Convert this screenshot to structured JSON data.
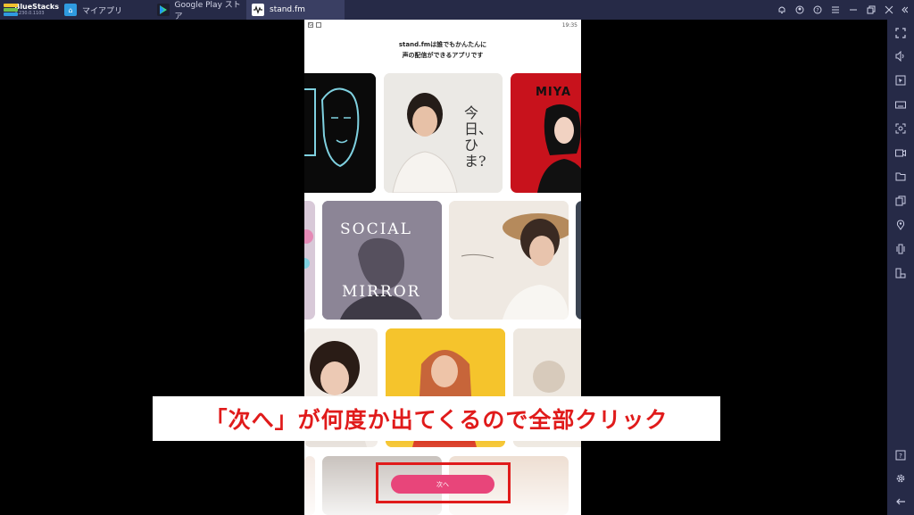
{
  "app": {
    "name": "BlueStacks",
    "version": "4.230.0.1103"
  },
  "tabs": [
    {
      "label": "マイアプリ",
      "icon": "home-icon",
      "active": false
    },
    {
      "label": "Google Play ストア",
      "icon": "play-store-icon",
      "active": false
    },
    {
      "label": "stand.fm",
      "icon": "standfm-icon",
      "active": true
    }
  ],
  "window_controls": [
    "bell-icon",
    "account-icon",
    "help-icon",
    "menu-icon",
    "minimize-icon",
    "restore-icon",
    "close-icon"
  ],
  "sidebar": {
    "top_icons": [
      "fullscreen-icon",
      "volume-icon",
      "cursor-icon",
      "keyboard-icon",
      "screenshot-icon",
      "record-icon",
      "folder-icon",
      "multi-instance-icon",
      "location-icon",
      "shake-icon",
      "rotate-icon"
    ],
    "bottom_icons": [
      "help-icon",
      "settings-icon",
      "back-icon"
    ]
  },
  "phone": {
    "status": {
      "time": "19:35",
      "left_glyph": "G"
    },
    "headline_line1": "stand.fmは誰でもかんたんに",
    "headline_line2": "声の配信ができるアプリです",
    "cards": {
      "social_line1": "SOCIAL",
      "social_line2": "MIRROR",
      "miya": "MIYA",
      "hima_text": "今日、ひま?"
    },
    "next_button": "次へ"
  },
  "colors": {
    "titlebar": "#262a47",
    "accent_pink": "#e8457a",
    "annotation_red": "#e01b1b"
  },
  "annotation": {
    "caption": "「次へ」が何度か出てくるので全部クリック"
  }
}
